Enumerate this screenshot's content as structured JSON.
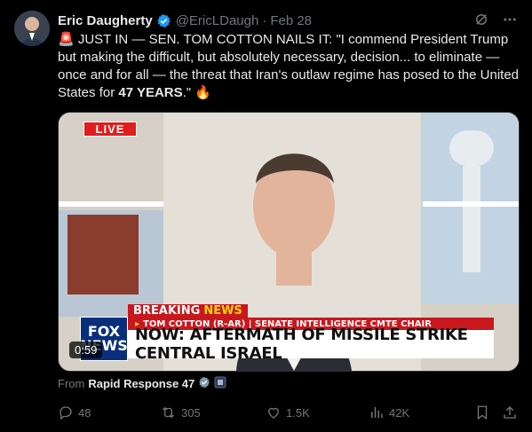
{
  "tweet": {
    "author_name": "Eric Daugherty",
    "handle": "@EricLDaugh",
    "date": "Feb 28",
    "text_part1": "🚨 JUST IN — SEN. TOM COTTON NAILS IT: \"I commend President Trump but making the difficult, but absolutely necessary, decision... to eliminate — once and for all — the threat that Iran's outlaw regime has posed to the United States for ",
    "text_bold": "47 YEARS",
    "text_part2": ".\" 🔥"
  },
  "video": {
    "live_badge": "LIVE",
    "breaking_label_1": "BREAKING",
    "breaking_label_2": "NEWS",
    "byline": "TOM COTTON (R-AR) | SENATE INTELLIGENCE CMTE CHAIR",
    "headline": "NOW: AFTERMATH OF MISSILE STRIKE CENTRAL ISRAEL",
    "logo_line1": "FOX",
    "logo_line2": "NEWS",
    "duration": "0:59"
  },
  "source": {
    "prefix": "From",
    "name": "Rapid Response 47"
  },
  "actions": {
    "replies": "48",
    "reposts": "305",
    "likes": "1.5K",
    "views": "42K"
  },
  "colors": {
    "background": "#000000",
    "text": "#e7e9ea",
    "muted": "#71767b",
    "verified": "#1d9bf0",
    "fox_red": "#c8181e"
  }
}
